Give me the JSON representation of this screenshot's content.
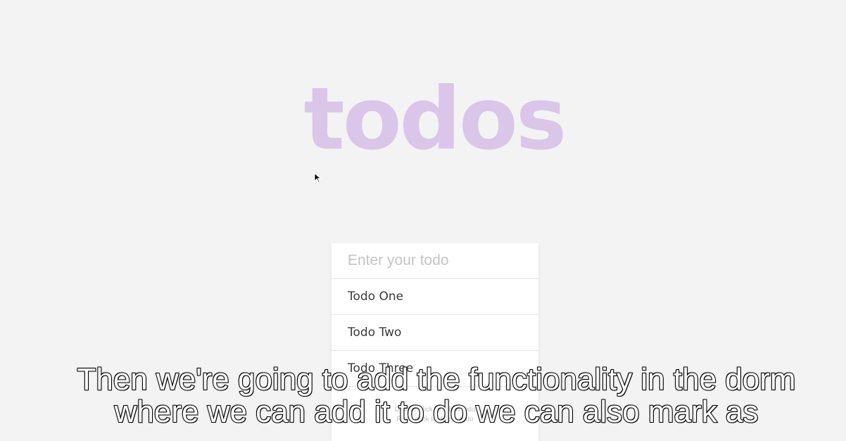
{
  "app": {
    "title": "todos"
  },
  "todo_input": {
    "placeholder": "Enter your todo",
    "value": ""
  },
  "todos": [
    {
      "label": "Todo One"
    },
    {
      "label": "Todo Two"
    },
    {
      "label": "Todo Three"
    }
  ],
  "footer": {
    "line1": "Double-click to edit a todo",
    "line2": "Right-click to delete todo"
  },
  "caption": {
    "line1": "Then we're going to add the functionality in the dorm",
    "line2": "where we can add it to do we can also mark as"
  },
  "colors": {
    "background": "#f3f3f3",
    "title": "#d9c6e9",
    "card": "#ffffff",
    "placeholder": "#c4c4c4"
  },
  "icons": {
    "cursor": "mouse-pointer-icon"
  }
}
